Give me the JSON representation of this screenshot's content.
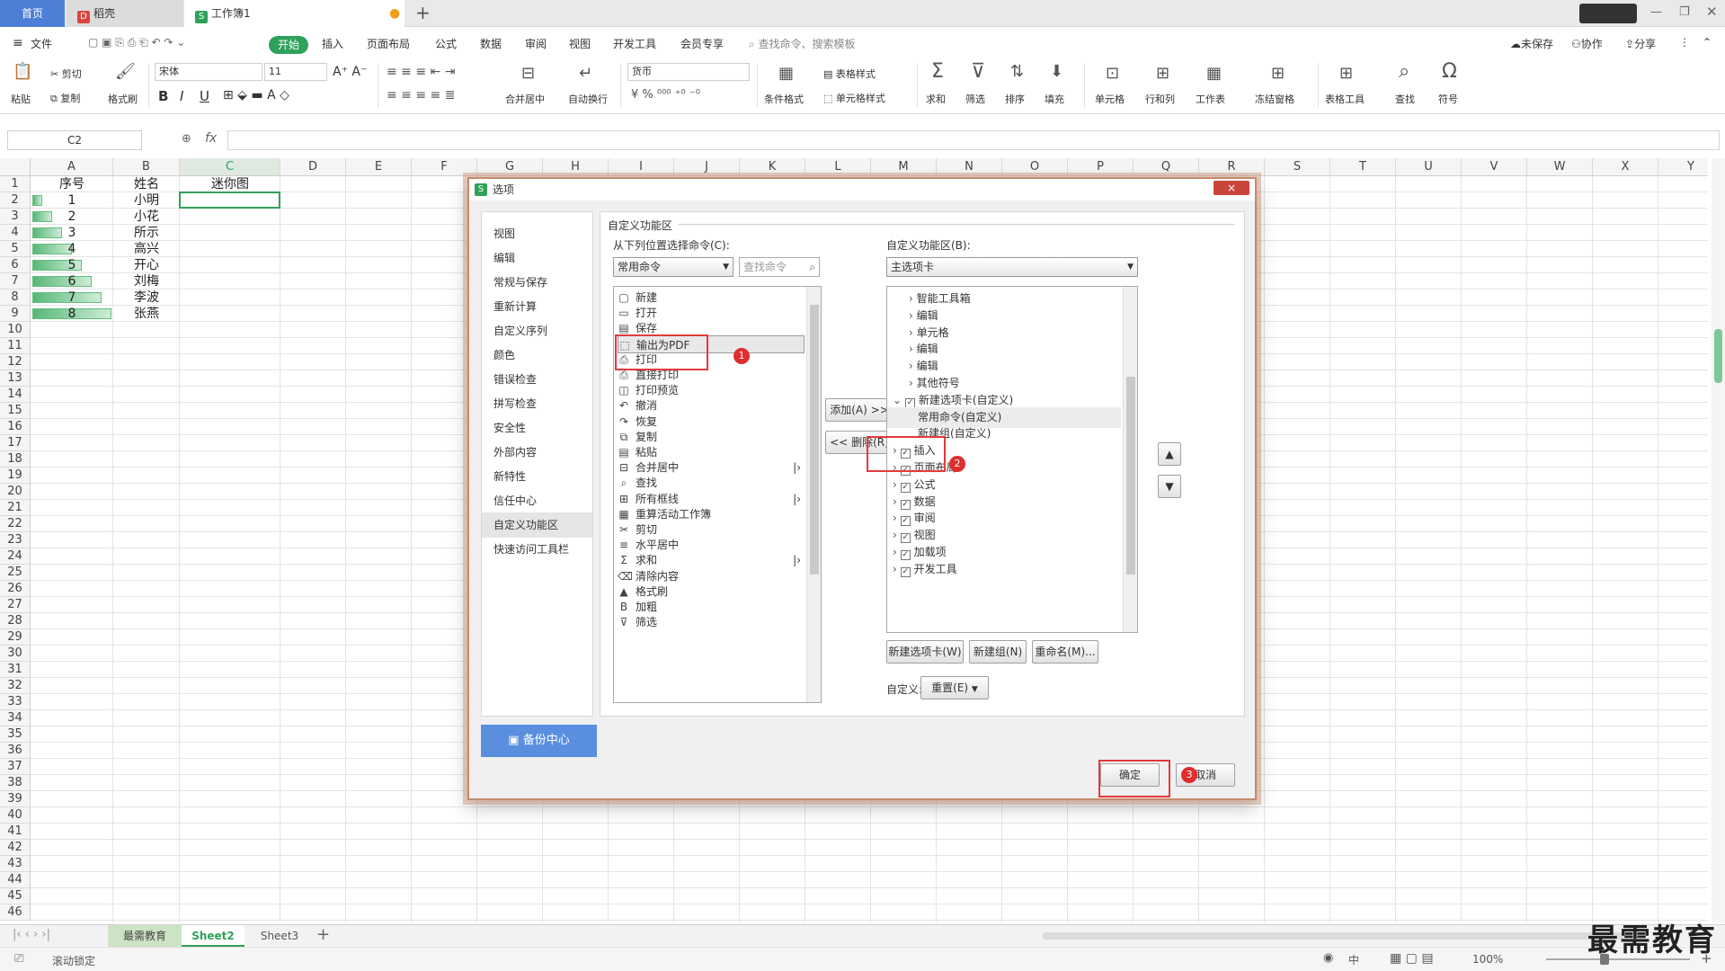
{
  "tabs": {
    "home": "首页",
    "docer": "稻壳",
    "workbook": "工作簿1",
    "add": "+"
  },
  "menubar": {
    "file": "文件",
    "start": "开始",
    "items": [
      "插入",
      "页面布局",
      "公式",
      "数据",
      "审阅",
      "视图",
      "开发工具",
      "会员专享"
    ],
    "search": "查找命令、搜索模板",
    "unsaved": "未保存",
    "collab": "协作",
    "share": "分享"
  },
  "ribbon": {
    "paste": "粘贴",
    "cut": "剪切",
    "copy": "复制",
    "format_painter": "格式刷",
    "font_name": "宋体",
    "font_size": "11",
    "merge_center": "合并居中",
    "auto_wrap": "自动换行",
    "number_format": "货币",
    "cond_format": "条件格式",
    "table_style": "表格样式",
    "cell_style": "单元格样式",
    "sum": "求和",
    "filter": "筛选",
    "sort": "排序",
    "fill": "填充",
    "cell": "单元格",
    "row_col": "行和列",
    "worksheet": "工作表",
    "freeze": "冻结窗格",
    "table_tools": "表格工具",
    "find": "查找",
    "symbol": "符号"
  },
  "formula": {
    "name_box": "C2",
    "fx": "fx"
  },
  "grid": {
    "columns": [
      "A",
      "B",
      "C",
      "D",
      "E",
      "F",
      "G",
      "H",
      "I",
      "J",
      "K",
      "L",
      "M",
      "N",
      "O",
      "P",
      "Q",
      "R",
      "S",
      "T",
      "U",
      "V",
      "W",
      "X",
      "Y"
    ],
    "rows": [
      "1",
      "2",
      "3",
      "4",
      "5",
      "6",
      "7",
      "8",
      "9",
      "10",
      "11",
      "12",
      "13",
      "14",
      "15",
      "16",
      "17",
      "18",
      "19",
      "20",
      "21",
      "22",
      "23",
      "24",
      "25",
      "26",
      "27",
      "28",
      "29",
      "30",
      "31",
      "32",
      "33",
      "34",
      "35",
      "36",
      "37",
      "38",
      "39",
      "40",
      "41",
      "42",
      "43",
      "44",
      "45",
      "46"
    ],
    "header_a": "序号",
    "header_b": "姓名",
    "header_c": "迷你图",
    "seq": [
      "1",
      "2",
      "3",
      "4",
      "5",
      "6",
      "7",
      "8"
    ],
    "seq_fraction": [
      0.125,
      0.25,
      0.375,
      0.5,
      0.625,
      0.75,
      0.875,
      1.0
    ],
    "names": [
      "小明",
      "小花",
      "所示",
      "高兴",
      "开心",
      "刘梅",
      "李波",
      "张燕"
    ]
  },
  "sheets": {
    "tabs": [
      "最需教育",
      "Sheet2",
      "Sheet3"
    ],
    "active": "Sheet2",
    "add": "+"
  },
  "status": {
    "scroll_lock": "滚动锁定",
    "zoom": "100%",
    "input_mode": "中"
  },
  "watermark": "最需教育",
  "dialog": {
    "title": "选项",
    "close": "×",
    "nav": [
      "视图",
      "编辑",
      "常规与保存",
      "重新计算",
      "自定义序列",
      "颜色",
      "错误检查",
      "拼写检查",
      "安全性",
      "外部内容",
      "新特性",
      "信任中心",
      "自定义功能区",
      "快速访问工具栏"
    ],
    "nav_selected": "自定义功能区",
    "backup": "备份中心",
    "section_title": "自定义功能区",
    "left_label": "从下列位置选择命令(C):",
    "left_dropdown": "常用命令",
    "search_placeholder": "查找命令",
    "commands": [
      "新建",
      "打开",
      "保存",
      "输出为PDF",
      "打印",
      "直接打印",
      "打印预览",
      "撤消",
      "恢复",
      "复制",
      "粘贴",
      "合并居中",
      "查找",
      "所有框线",
      "重算活动工作簿",
      "剪切",
      "水平居中",
      "求和",
      "清除内容",
      "格式刷",
      "加粗",
      "筛选"
    ],
    "add_button": "添加(A) >>",
    "remove_button": "<< 删除(R)",
    "right_label": "自定义功能区(B):",
    "right_dropdown": "主选项卡",
    "tree": [
      {
        "label": "智能工具箱",
        "level": 2,
        "check": false
      },
      {
        "label": "编辑",
        "level": 2,
        "check": false
      },
      {
        "label": "单元格",
        "level": 2,
        "check": false
      },
      {
        "label": "编辑",
        "level": 2,
        "check": false
      },
      {
        "label": "编辑",
        "level": 2,
        "check": false
      },
      {
        "label": "其他符号",
        "level": 2,
        "check": false
      },
      {
        "label": "新建选项卡(自定义)",
        "level": 1,
        "check": true
      },
      {
        "label": "常用命令(自定义)",
        "level": 3,
        "check": false
      },
      {
        "label": "新建组(自定义)",
        "level": 3,
        "check": false
      },
      {
        "label": "插入",
        "level": 1,
        "check": true
      },
      {
        "label": "页面布局",
        "level": 1,
        "check": true
      },
      {
        "label": "公式",
        "level": 1,
        "check": true
      },
      {
        "label": "数据",
        "level": 1,
        "check": true
      },
      {
        "label": "审阅",
        "level": 1,
        "check": true
      },
      {
        "label": "视图",
        "level": 1,
        "check": true
      },
      {
        "label": "加载项",
        "level": 1,
        "check": true
      },
      {
        "label": "开发工具",
        "level": 1,
        "check": true
      }
    ],
    "new_tab": "新建选项卡(W)",
    "new_group": "新建组(N)",
    "rename": "重命名(M)...",
    "customize_label": "自定义:",
    "reset": "重置(E)",
    "ok": "确定",
    "cancel": "取消",
    "badges": [
      "1",
      "2",
      "3"
    ]
  },
  "colors": {
    "accent_green": "#2fa15a",
    "highlight_red": "#e23a3a",
    "tab_blue": "#4e7fd6",
    "databar": "#63be7b"
  }
}
